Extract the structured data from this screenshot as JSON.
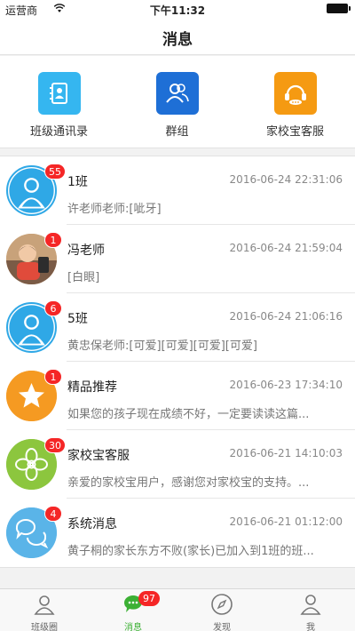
{
  "status_bar": {
    "carrier": "运营商",
    "time": "下午11:32"
  },
  "nav": {
    "title": "消息"
  },
  "quick_actions": [
    {
      "label": "班级通讯录",
      "icon": "contacts-book-icon",
      "color": "#35b6f0"
    },
    {
      "label": "群组",
      "icon": "group-users-icon",
      "color": "#1e6fd6"
    },
    {
      "label": "家校宝客服",
      "icon": "headset-icon",
      "color": "#f59a12"
    }
  ],
  "messages": [
    {
      "name": "1班",
      "time": "2016-06-24 22:31:06",
      "preview": "许老师老师:[呲牙]",
      "badge": "55",
      "avatar": "group-avatar-icon",
      "avatar_color": "#2fa8e6"
    },
    {
      "name": "冯老师",
      "time": "2016-06-24 21:59:04",
      "preview": "[白眼]",
      "badge": "1",
      "avatar": "user-photo",
      "avatar_color": "#d9a46a"
    },
    {
      "name": "5班",
      "time": "2016-06-24 21:06:16",
      "preview": "黄忠保老师:[可爱][可爱][可爱][可爱]",
      "badge": "6",
      "avatar": "group-avatar-icon",
      "avatar_color": "#2fa8e6"
    },
    {
      "name": "精品推荐",
      "time": "2016-06-23 17:34:10",
      "preview": "如果您的孩子现在成绩不好，一定要读读这篇...",
      "badge": "1",
      "avatar": "star-icon",
      "avatar_color": "#f59a22"
    },
    {
      "name": "家校宝客服",
      "time": "2016-06-21 14:10:03",
      "preview": "亲爱的家校宝用户，感谢您对家校宝的支持。...",
      "badge": "30",
      "avatar": "flower-logo-icon",
      "avatar_color": "#8cc63e"
    },
    {
      "name": "系统消息",
      "time": "2016-06-21 01:12:00",
      "preview": "黄子桐的家长东方不败(家长)已加入到1班的班...",
      "badge": "4",
      "avatar": "chat-bubbles-icon",
      "avatar_color": "#5ab4e8"
    }
  ],
  "tabs": [
    {
      "label": "班级圈",
      "icon": "class-circle-icon",
      "active": false
    },
    {
      "label": "消息",
      "icon": "message-icon",
      "active": true,
      "badge": "97"
    },
    {
      "label": "发现",
      "icon": "compass-icon",
      "active": false
    },
    {
      "label": "我",
      "icon": "profile-icon",
      "active": false
    }
  ],
  "colors": {
    "accent": "#3cb034",
    "badge": "#f52626"
  }
}
